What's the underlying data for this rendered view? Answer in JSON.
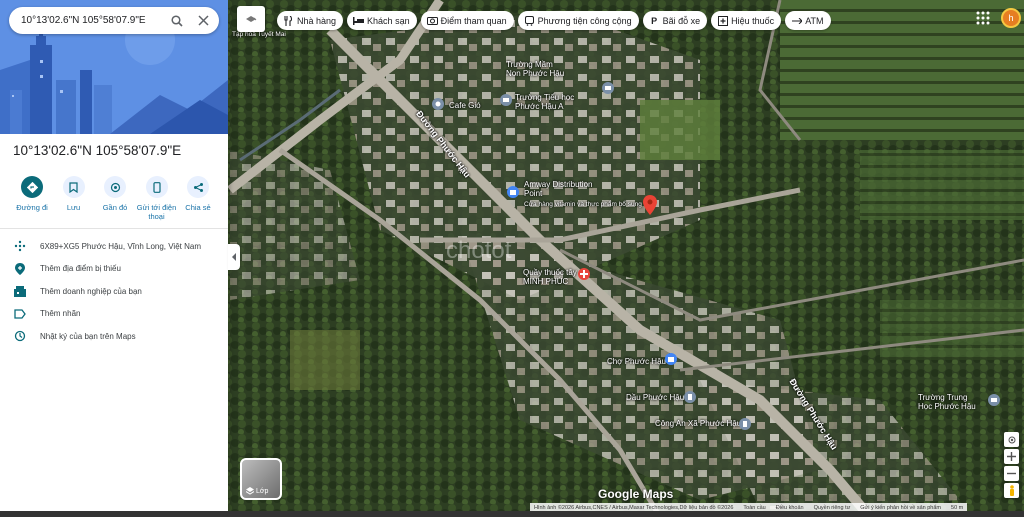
{
  "search": {
    "query": "10°13'02.6\"N 105°58'07.9\"E"
  },
  "place": {
    "title": "10°13'02.6\"N 105°58'07.9\"E"
  },
  "actions": [
    {
      "label": "Đường đi",
      "icon": "directions-icon"
    },
    {
      "label": "Lưu",
      "icon": "bookmark-icon"
    },
    {
      "label": "Gần đó",
      "icon": "nearby-icon"
    },
    {
      "label": "Gửi tới điện thoại",
      "icon": "phone-icon"
    },
    {
      "label": "Chia sẻ",
      "icon": "share-icon"
    }
  ],
  "details": [
    {
      "text": "6X89+XG5 Phước Hậu, Vĩnh Long, Việt Nam",
      "icon": "plus-code-icon"
    },
    {
      "text": "Thêm địa điểm bị thiếu",
      "icon": "add-place-icon"
    },
    {
      "text": "Thêm doanh nghiệp của bạn",
      "icon": "business-icon"
    },
    {
      "text": "Thêm nhãn",
      "icon": "label-icon"
    },
    {
      "text": "Nhật ký của bạn trên Maps",
      "icon": "history-icon"
    }
  ],
  "chips": [
    {
      "label": "Nhà hàng",
      "icon": "restaurant-icon"
    },
    {
      "label": "Khách sạn",
      "icon": "hotel-icon"
    },
    {
      "label": "Điểm tham quan",
      "icon": "camera-icon"
    },
    {
      "label": "Phương tiện công cộng",
      "icon": "transit-icon"
    },
    {
      "label": "Bãi đỗ xe",
      "icon": "parking-icon"
    },
    {
      "label": "Hiệu thuốc",
      "icon": "pharmacy-icon"
    },
    {
      "label": "ATM",
      "icon": "atm-icon"
    }
  ],
  "user": {
    "initial": "h",
    "avatar_color": "#e67e22"
  },
  "map": {
    "labels": {
      "tap_hoa": "Tạp hoá Tuyết Mai",
      "mam_non": "Trường Mầm Non Phước Hậu",
      "cafe": "Cafe Gió",
      "tieu_hoc": "Trường Tiểu học Phước Hậu A",
      "road1": "Đường Phước Hậu",
      "amway": "Amway Distribution Point",
      "amway_sub": "Cửa hàng vitamin và thực phẩm bổ sung",
      "quay_thuoc": "Quầy thuốc tây MINH PHÚC",
      "cho": "Chợ Phước Hậu",
      "dau": "Dầu Phước Hậu",
      "cong_an": "Công An Xã Phước Hậu",
      "road2": "Đường Phước Hậu",
      "trung_hoc": "Trường Trung Học Phước Hậu",
      "watermark": "chotot"
    },
    "layers_label": "Lớp",
    "logo": "Google Maps",
    "attribution": "Hình ảnh ©2026 Airbus,CNES / Airbus,Maxar Technologies,Dữ liệu bản đồ ©2026",
    "attr_links": [
      "Toàn cầu",
      "Điều khoản",
      "Quyền riêng tư",
      "Gửi ý kiến phản hồi về sản phẩm"
    ],
    "scale": "50 m",
    "pin_color": "#ea4335"
  }
}
